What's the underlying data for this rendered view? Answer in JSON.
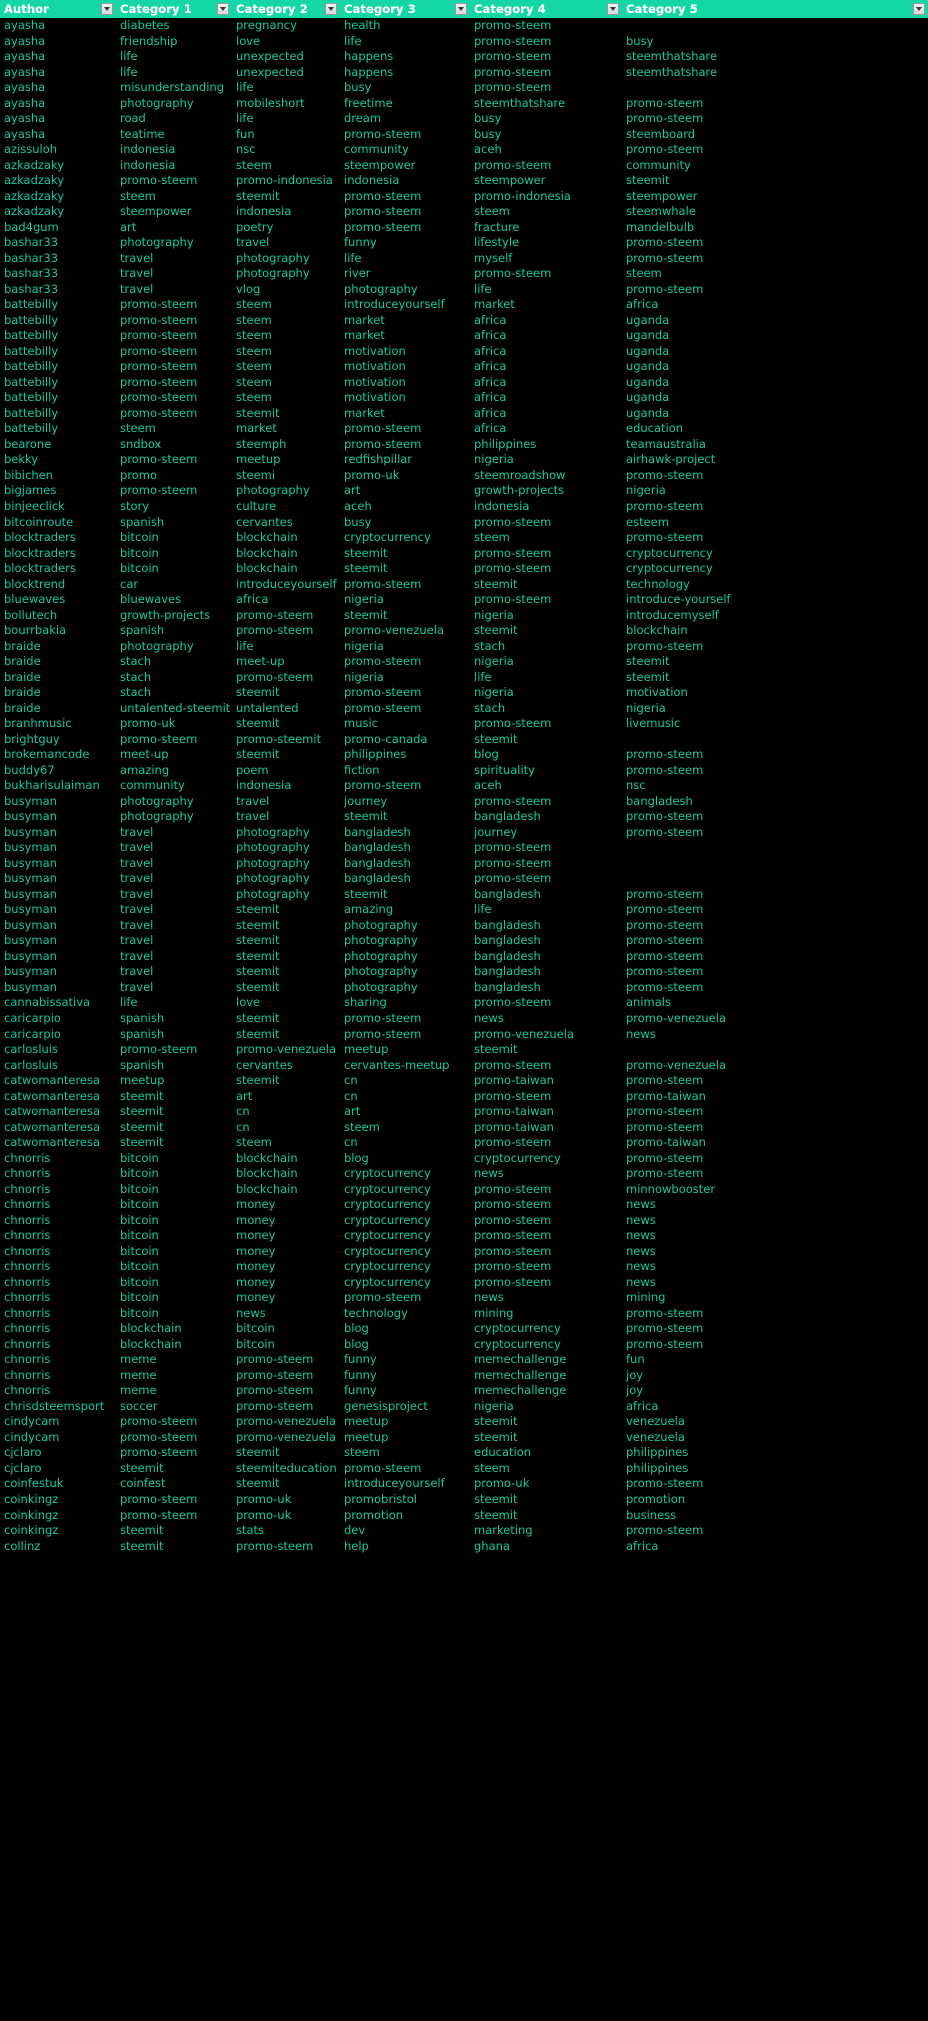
{
  "table": {
    "headers": [
      {
        "label": "Author",
        "filter_icon": "chevron-down-icon"
      },
      {
        "label": "Category 1",
        "filter_icon": "chevron-down-icon"
      },
      {
        "label": "Category 2",
        "filter_icon": "chevron-down-icon"
      },
      {
        "label": "Category 3",
        "filter_icon": "chevron-down-icon"
      },
      {
        "label": "Category 4",
        "filter_icon": "chevron-down-icon"
      },
      {
        "label": "Category 5",
        "filter_icon": "chevron-down-icon"
      }
    ],
    "colors": {
      "header_background": "#15D6A5",
      "header_text": "#FFFFFF",
      "body_background": "#000000",
      "body_text": "#18C99C"
    },
    "rows": [
      [
        "ayasha",
        "diabetes",
        "pregnancy",
        "health",
        "promo-steem",
        ""
      ],
      [
        "ayasha",
        "friendship",
        "love",
        "life",
        "promo-steem",
        "busy"
      ],
      [
        "ayasha",
        "life",
        "unexpected",
        "happens",
        "promo-steem",
        "steemthatshare"
      ],
      [
        "ayasha",
        "life",
        "unexpected",
        "happens",
        "promo-steem",
        "steemthatshare"
      ],
      [
        "ayasha",
        "misunderstanding",
        "life",
        "busy",
        "promo-steem",
        ""
      ],
      [
        "ayasha",
        "photography",
        "mobileshort",
        "freetime",
        "steemthatshare",
        "promo-steem"
      ],
      [
        "ayasha",
        "road",
        "life",
        "dream",
        "busy",
        "promo-steem"
      ],
      [
        "ayasha",
        "teatime",
        "fun",
        "promo-steem",
        "busy",
        "steemboard"
      ],
      [
        "azissuloh",
        "indonesia",
        "nsc",
        "community",
        "aceh",
        "promo-steem"
      ],
      [
        "azkadzaky",
        "indonesia",
        "steem",
        "steempower",
        "promo-steem",
        "community"
      ],
      [
        "azkadzaky",
        "promo-steem",
        "promo-indonesia",
        "indonesia",
        "steempower",
        "steemit"
      ],
      [
        "azkadzaky",
        "steem",
        "steemit",
        "promo-steem",
        "promo-indonesia",
        "steempower"
      ],
      [
        "azkadzaky",
        "steempower",
        "indonesia",
        "promo-steem",
        "steem",
        "steemwhale"
      ],
      [
        "bad4gum",
        "art",
        "poetry",
        "promo-steem",
        "fracture",
        "mandelbulb"
      ],
      [
        "bashar33",
        "photography",
        "travel",
        "funny",
        "lifestyle",
        "promo-steem"
      ],
      [
        "bashar33",
        "travel",
        "photography",
        "life",
        "myself",
        "promo-steem"
      ],
      [
        "bashar33",
        "travel",
        "photography",
        "river",
        "promo-steem",
        "steem"
      ],
      [
        "bashar33",
        "travel",
        "vlog",
        "photography",
        "life",
        "promo-steem"
      ],
      [
        "battebilly",
        "promo-steem",
        "steem",
        "introduceyourself",
        "market",
        "africa"
      ],
      [
        "battebilly",
        "promo-steem",
        "steem",
        "market",
        "africa",
        "uganda"
      ],
      [
        "battebilly",
        "promo-steem",
        "steem",
        "market",
        "africa",
        "uganda"
      ],
      [
        "battebilly",
        "promo-steem",
        "steem",
        "motivation",
        "africa",
        "uganda"
      ],
      [
        "battebilly",
        "promo-steem",
        "steem",
        "motivation",
        "africa",
        "uganda"
      ],
      [
        "battebilly",
        "promo-steem",
        "steem",
        "motivation",
        "africa",
        "uganda"
      ],
      [
        "battebilly",
        "promo-steem",
        "steem",
        "motivation",
        "africa",
        "uganda"
      ],
      [
        "battebilly",
        "promo-steem",
        "steemit",
        "market",
        "africa",
        "uganda"
      ],
      [
        "battebilly",
        "steem",
        "market",
        "promo-steem",
        "africa",
        "education"
      ],
      [
        "bearone",
        "sndbox",
        "steemph",
        "promo-steem",
        "philippines",
        "teamaustralia"
      ],
      [
        "bekky",
        "promo-steem",
        "meetup",
        "redfishpillar",
        "nigeria",
        "airhawk-project"
      ],
      [
        "bibichen",
        "promo",
        "steemi",
        "promo-uk",
        "steemroadshow",
        "promo-steem"
      ],
      [
        "bigjames",
        "promo-steem",
        "photography",
        "art",
        "growth-projects",
        "nigeria"
      ],
      [
        "binjeeclick",
        "story",
        "culture",
        "aceh",
        "indonesia",
        "promo-steem"
      ],
      [
        "bitcoinroute",
        "spanish",
        "cervantes",
        "busy",
        "promo-steem",
        "esteem"
      ],
      [
        "blocktraders",
        "bitcoin",
        "blockchain",
        "cryptocurrency",
        "steem",
        "promo-steem"
      ],
      [
        "blocktraders",
        "bitcoin",
        "blockchain",
        "steemit",
        "promo-steem",
        "cryptocurrency"
      ],
      [
        "blocktraders",
        "bitcoin",
        "blockchain",
        "steemit",
        "promo-steem",
        "cryptocurrency"
      ],
      [
        "blocktrend",
        "car",
        "introduceyourself",
        "promo-steem",
        "steemit",
        "technology"
      ],
      [
        "bluewaves",
        "bluewaves",
        "africa",
        "nigeria",
        "promo-steem",
        "introduce-yourself"
      ],
      [
        "bollutech",
        "growth-projects",
        "promo-steem",
        "steemit",
        "nigeria",
        "introducemyself"
      ],
      [
        "bourrbakia",
        "spanish",
        "promo-steem",
        "promo-venezuela",
        "steemit",
        "blockchain"
      ],
      [
        "braide",
        "photography",
        "life",
        "nigeria",
        "stach",
        "promo-steem"
      ],
      [
        "braide",
        "stach",
        "meet-up",
        "promo-steem",
        "nigeria",
        "steemit"
      ],
      [
        "braide",
        "stach",
        "promo-steem",
        "nigeria",
        "life",
        "steemit"
      ],
      [
        "braide",
        "stach",
        "steemit",
        "promo-steem",
        "nigeria",
        "motivation"
      ],
      [
        "braide",
        "untalented-steemit",
        "untalented",
        "promo-steem",
        "stach",
        "nigeria"
      ],
      [
        "branhmusic",
        "promo-uk",
        "steemit",
        "music",
        "promo-steem",
        "livemusic"
      ],
      [
        "brightguy",
        "promo-steem",
        "promo-steemit",
        "promo-canada",
        "steemit",
        ""
      ],
      [
        "brokemancode",
        "meet-up",
        "steemit",
        "philippines",
        "blog",
        "promo-steem"
      ],
      [
        "buddy67",
        "amazing",
        "poem",
        "fiction",
        "spirituality",
        "promo-steem"
      ],
      [
        "bukharisulaiman",
        "community",
        "indonesia",
        "promo-steem",
        "aceh",
        "nsc"
      ],
      [
        "busyman",
        "photography",
        "travel",
        "journey",
        "promo-steem",
        "bangladesh"
      ],
      [
        "busyman",
        "photography",
        "travel",
        "steemit",
        "bangladesh",
        "promo-steem"
      ],
      [
        "busyman",
        "travel",
        "photography",
        "bangladesh",
        "journey",
        "promo-steem"
      ],
      [
        "busyman",
        "travel",
        "photography",
        "bangladesh",
        "promo-steem",
        ""
      ],
      [
        "busyman",
        "travel",
        "photography",
        "bangladesh",
        "promo-steem",
        ""
      ],
      [
        "busyman",
        "travel",
        "photography",
        "bangladesh",
        "promo-steem",
        ""
      ],
      [
        "busyman",
        "travel",
        "photography",
        "steemit",
        "bangladesh",
        "promo-steem"
      ],
      [
        "busyman",
        "travel",
        "steemit",
        "amazing",
        "life",
        "promo-steem"
      ],
      [
        "busyman",
        "travel",
        "steemit",
        "photography",
        "bangladesh",
        "promo-steem"
      ],
      [
        "busyman",
        "travel",
        "steemit",
        "photography",
        "bangladesh",
        "promo-steem"
      ],
      [
        "busyman",
        "travel",
        "steemit",
        "photography",
        "bangladesh",
        "promo-steem"
      ],
      [
        "busyman",
        "travel",
        "steemit",
        "photography",
        "bangladesh",
        "promo-steem"
      ],
      [
        "busyman",
        "travel",
        "steemit",
        "photography",
        "bangladesh",
        "promo-steem"
      ],
      [
        "cannabissativa",
        "life",
        "love",
        "sharing",
        "promo-steem",
        "animals"
      ],
      [
        "caricarpio",
        "spanish",
        "steemit",
        "promo-steem",
        "news",
        "promo-venezuela"
      ],
      [
        "caricarpio",
        "spanish",
        "steemit",
        "promo-steem",
        "promo-venezuela",
        "news"
      ],
      [
        "carlosluis",
        "promo-steem",
        "promo-venezuela",
        "meetup",
        "steemit",
        ""
      ],
      [
        "carlosluis",
        "spanish",
        "cervantes",
        "cervantes-meetup",
        "promo-steem",
        "promo-venezuela"
      ],
      [
        "catwomanteresa",
        "meetup",
        "steemit",
        "cn",
        "promo-taiwan",
        "promo-steem"
      ],
      [
        "catwomanteresa",
        "steemit",
        "art",
        "cn",
        "promo-steem",
        "promo-taiwan"
      ],
      [
        "catwomanteresa",
        "steemit",
        "cn",
        "art",
        "promo-taiwan",
        "promo-steem"
      ],
      [
        "catwomanteresa",
        "steemit",
        "cn",
        "steem",
        "promo-taiwan",
        "promo-steem"
      ],
      [
        "catwomanteresa",
        "steemit",
        "steem",
        "cn",
        "promo-steem",
        "promo-taiwan"
      ],
      [
        "chnorris",
        "bitcoin",
        "blockchain",
        "blog",
        "cryptocurrency",
        "promo-steem"
      ],
      [
        "chnorris",
        "bitcoin",
        "blockchain",
        "cryptocurrency",
        "news",
        "promo-steem"
      ],
      [
        "chnorris",
        "bitcoin",
        "blockchain",
        "cryptocurrency",
        "promo-steem",
        "minnowbooster"
      ],
      [
        "chnorris",
        "bitcoin",
        "money",
        "cryptocurrency",
        "promo-steem",
        "news"
      ],
      [
        "chnorris",
        "bitcoin",
        "money",
        "cryptocurrency",
        "promo-steem",
        "news"
      ],
      [
        "chnorris",
        "bitcoin",
        "money",
        "cryptocurrency",
        "promo-steem",
        "news"
      ],
      [
        "chnorris",
        "bitcoin",
        "money",
        "cryptocurrency",
        "promo-steem",
        "news"
      ],
      [
        "chnorris",
        "bitcoin",
        "money",
        "cryptocurrency",
        "promo-steem",
        "news"
      ],
      [
        "chnorris",
        "bitcoin",
        "money",
        "cryptocurrency",
        "promo-steem",
        "news"
      ],
      [
        "chnorris",
        "bitcoin",
        "money",
        "promo-steem",
        "news",
        "mining"
      ],
      [
        "chnorris",
        "bitcoin",
        "news",
        "technology",
        "mining",
        "promo-steem"
      ],
      [
        "chnorris",
        "blockchain",
        "bitcoin",
        "blog",
        "cryptocurrency",
        "promo-steem"
      ],
      [
        "chnorris",
        "blockchain",
        "bitcoin",
        "blog",
        "cryptocurrency",
        "promo-steem"
      ],
      [
        "chnorris",
        "meme",
        "promo-steem",
        "funny",
        "memechallenge",
        "fun"
      ],
      [
        "chnorris",
        "meme",
        "promo-steem",
        "funny",
        "memechallenge",
        "joy"
      ],
      [
        "chnorris",
        "meme",
        "promo-steem",
        "funny",
        "memechallenge",
        "joy"
      ],
      [
        "chrisdsteemsport",
        "soccer",
        "promo-steem",
        "genesisproject",
        "nigeria",
        "africa"
      ],
      [
        "cindycam",
        "promo-steem",
        "promo-venezuela",
        "meetup",
        "steemit",
        "venezuela"
      ],
      [
        "cindycam",
        "promo-steem",
        "promo-venezuela",
        "meetup",
        "steemit",
        "venezuela"
      ],
      [
        "cjclaro",
        "promo-steem",
        "steemit",
        "steem",
        "education",
        "philippines"
      ],
      [
        "cjclaro",
        "steemit",
        "steemiteducation",
        "promo-steem",
        "steem",
        "philippines"
      ],
      [
        "coinfestuk",
        "coinfest",
        "steemit",
        "introduceyourself",
        "promo-uk",
        "promo-steem"
      ],
      [
        "coinkingz",
        "promo-steem",
        "promo-uk",
        "promobristol",
        "steemit",
        "promotion"
      ],
      [
        "coinkingz",
        "promo-steem",
        "promo-uk",
        "promotion",
        "steemit",
        "business"
      ],
      [
        "coinkingz",
        "steemit",
        "stats",
        "dev",
        "marketing",
        "promo-steem"
      ],
      [
        "collinz",
        "steemit",
        "promo-steem",
        "help",
        "ghana",
        "africa"
      ]
    ]
  }
}
